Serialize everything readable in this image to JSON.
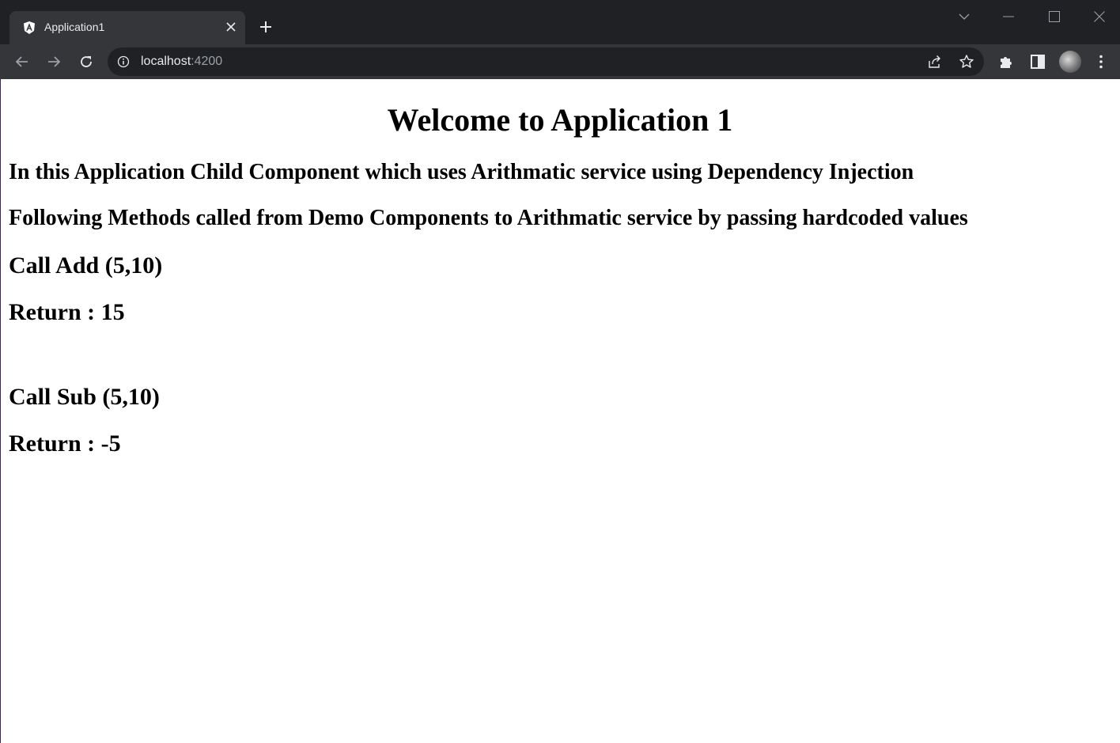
{
  "browser": {
    "tab": {
      "title": "Application1",
      "favicon": "angular-logo-icon"
    },
    "new_tab_icon": "plus-icon",
    "address_bar": {
      "host": "localhost",
      "port": ":4200",
      "info_icon": "info-icon"
    },
    "colors": {
      "frame": "#202124",
      "toolbar": "#35363a",
      "text": "#e8eaed",
      "muted": "#9aa0a6"
    }
  },
  "page": {
    "heading": "Welcome to Application 1",
    "intro": "In this Application Child Component which uses Arithmatic service using Dependency Injection",
    "description": "Following Methods called from Demo Components to Arithmatic service by passing hardcoded values",
    "add": {
      "call": "Call Add (5,10)",
      "result": "Return : 15"
    },
    "sub": {
      "call": "Call Sub (5,10)",
      "result": "Return : -5"
    }
  }
}
